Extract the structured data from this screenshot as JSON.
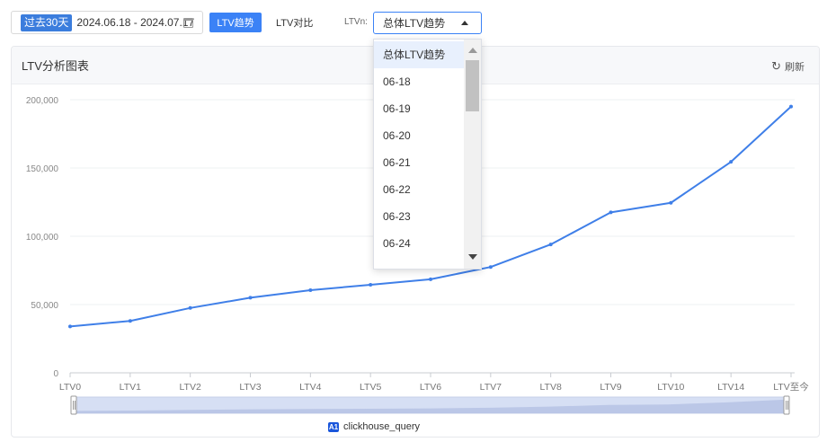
{
  "toolbar": {
    "range_tag": "过去30天",
    "date_range": "2024.06.18 - 2024.07.17",
    "tab_trend": "LTV趋势",
    "tab_compare": "LTV对比",
    "ltvn_label": "LTVn:",
    "select_value": "总体LTV趋势"
  },
  "panel": {
    "title": "LTV分析图表",
    "refresh_label": "刷新"
  },
  "dropdown": {
    "options": [
      "总体LTV趋势",
      "06-18",
      "06-19",
      "06-20",
      "06-21",
      "06-22",
      "06-23",
      "06-24"
    ],
    "selected_index": 0
  },
  "legend": {
    "badge": "A1",
    "label": "clickhouse_query"
  },
  "colors": {
    "accent": "#3b82f6",
    "line": "#3f7fe8",
    "grid": "#eef0f3",
    "zoom_fill": "#d6dff4"
  },
  "chart_data": {
    "type": "line",
    "categories": [
      "LTV0",
      "LTV1",
      "LTV2",
      "LTV3",
      "LTV4",
      "LTV5",
      "LTV6",
      "LTV7",
      "LTV8",
      "LTV9",
      "LTV10",
      "LTV14",
      "LTV至今"
    ],
    "series": [
      {
        "values": [
          34000,
          38000,
          47500,
          55000,
          60500,
          64500,
          68500,
          77500,
          94000,
          117500,
          124500,
          154500,
          195000
        ]
      }
    ],
    "yticks": [
      "0",
      "50,000",
      "100,000",
      "150,000",
      "200,000"
    ],
    "ylim": [
      0,
      200000
    ],
    "grid": true,
    "datazoom": true
  }
}
